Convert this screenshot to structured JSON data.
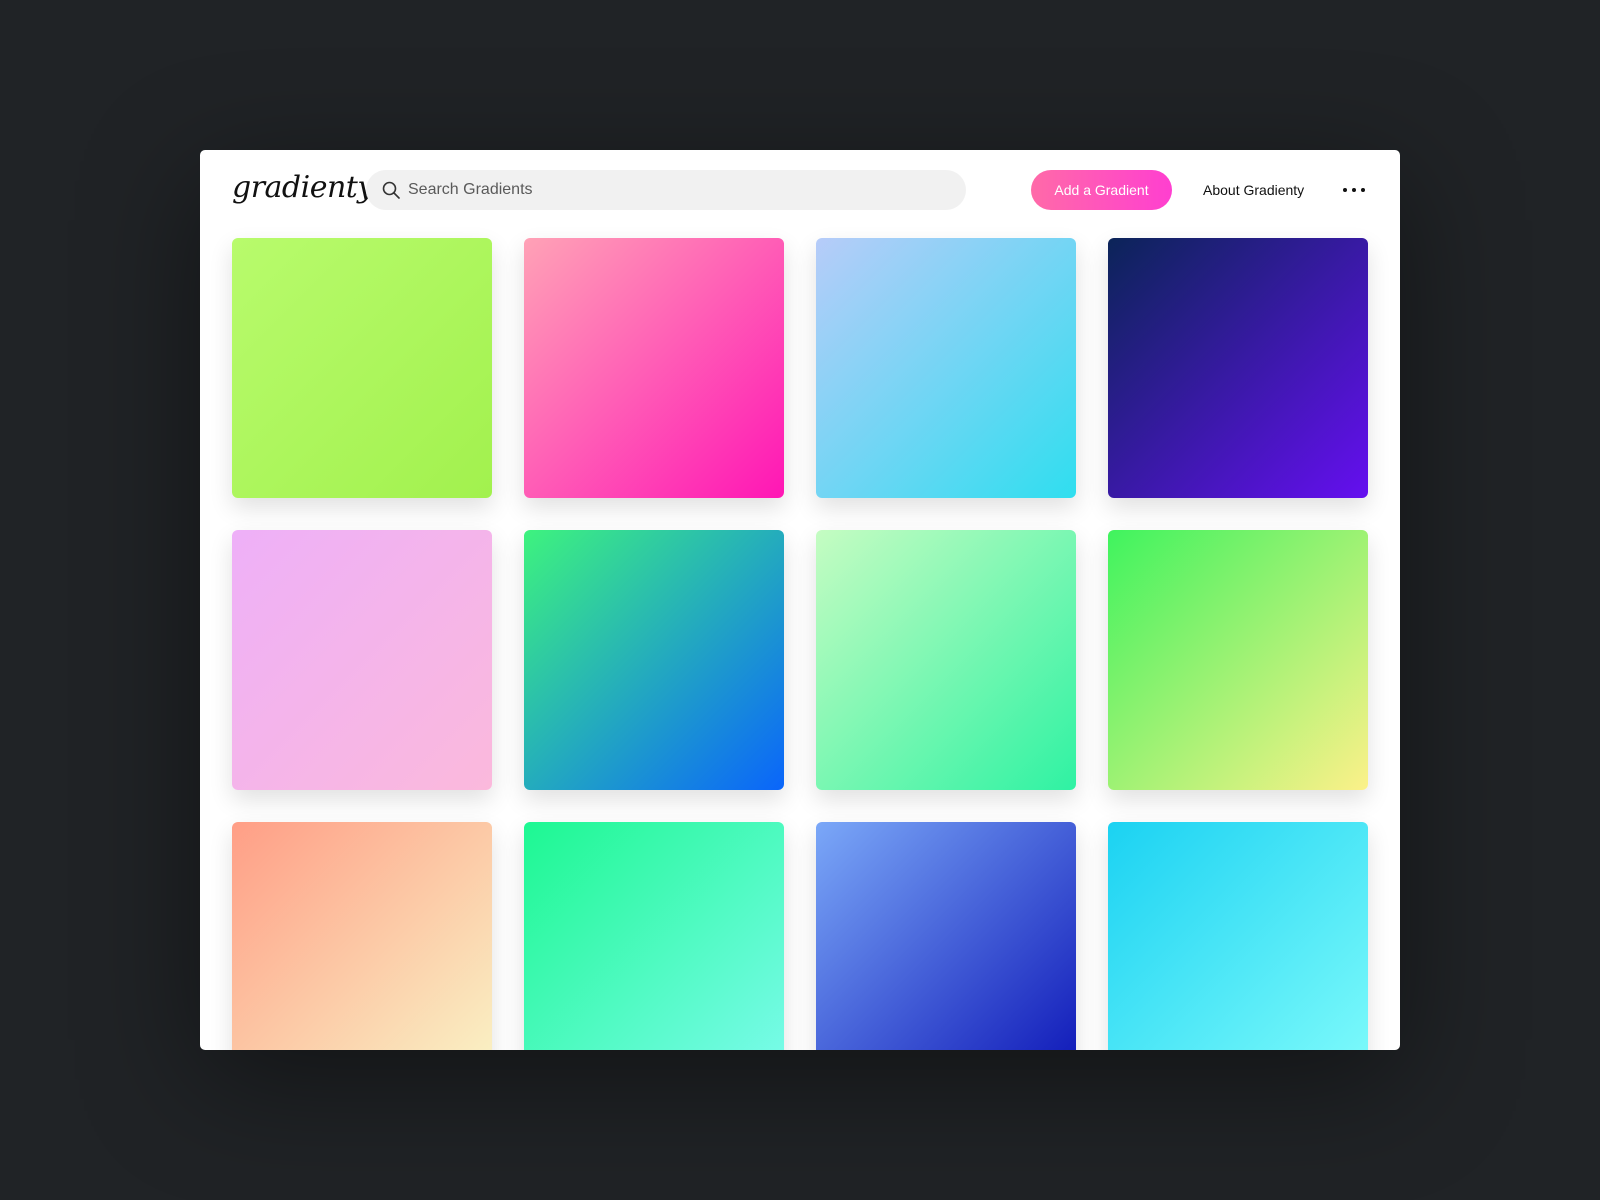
{
  "header": {
    "logo_text": "gradienty",
    "search": {
      "placeholder": "Search Gradients",
      "value": ""
    },
    "add_button_label": "Add a Gradient",
    "about_link_label": "About Gradienty"
  },
  "colors": {
    "page_background": "#202326",
    "window_background": "#ffffff",
    "add_button_gradient": [
      "#ff6aa8",
      "#ff3fd0"
    ]
  },
  "gradients": [
    {
      "from": "#b8fb6c",
      "to": "#a2f14e"
    },
    {
      "from": "#ffa2b6",
      "to": "#ff16b5"
    },
    {
      "from": "#b7ccf9",
      "to": "#2fdeef"
    },
    {
      "from": "#0b2458",
      "to": "#650ff0"
    },
    {
      "from": "#eeb0f8",
      "to": "#fbb9dc"
    },
    {
      "from": "#3ef37e",
      "to": "#0a65fb"
    },
    {
      "from": "#c5fcc2",
      "to": "#2ff2a3"
    },
    {
      "from": "#3ff35e",
      "to": "#fcf189"
    },
    {
      "from": "#ff9e86",
      "to": "#f9f4c6"
    },
    {
      "from": "#1df892",
      "to": "#7cfbec"
    },
    {
      "from": "#7ba8f8",
      "to": "#0d16b7"
    },
    {
      "from": "#1bd2f2",
      "to": "#7ffbfb"
    }
  ]
}
